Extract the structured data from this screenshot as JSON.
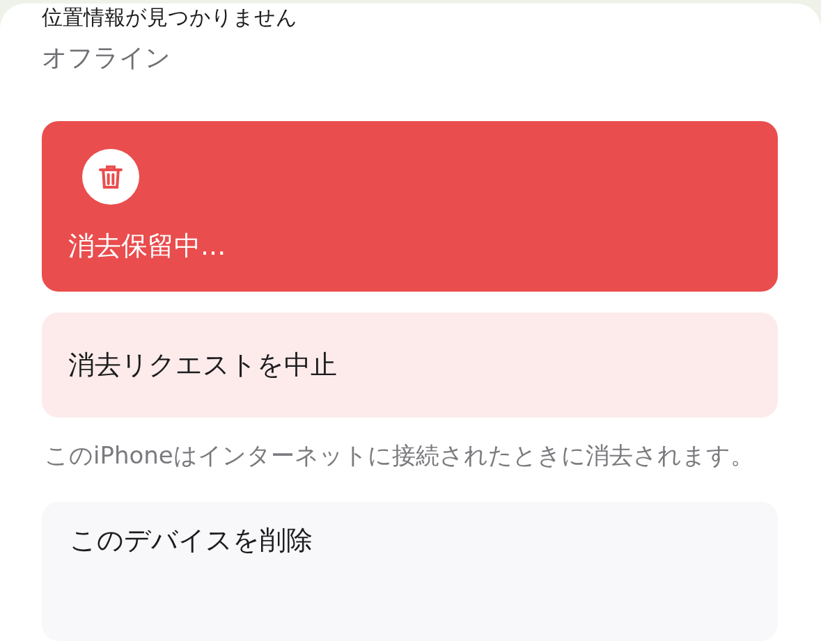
{
  "header": {
    "location_status": "位置情報が見つかりません",
    "connection": "オフライン"
  },
  "erase_status": {
    "label": "消去保留中..."
  },
  "cancel_button": {
    "label": "消去リクエストを中止"
  },
  "note": "このiPhoneはインターネットに接続されたときに消去されます。",
  "remove_button": {
    "label": "このデバイスを削除"
  }
}
